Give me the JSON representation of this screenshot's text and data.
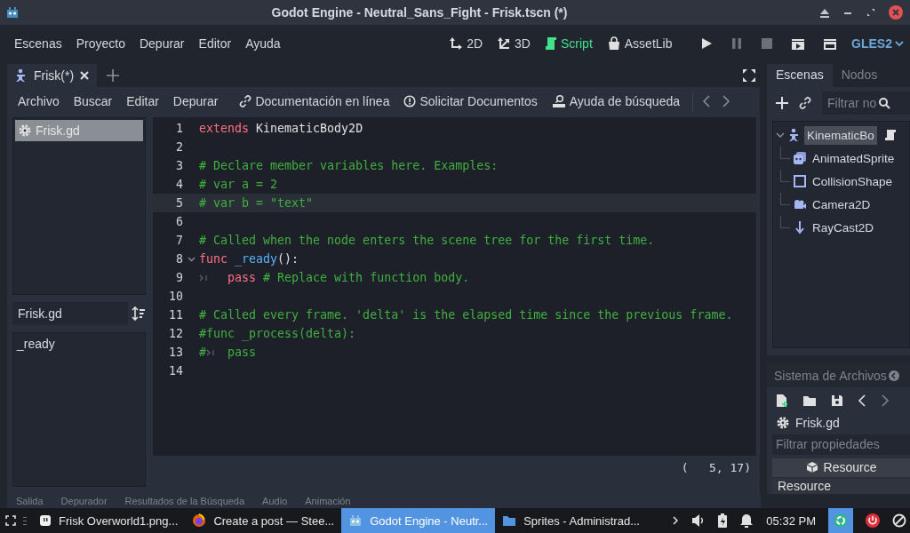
{
  "window": {
    "title": "Godot Engine - Neutral_Sans_Fight - Frisk.tscn (*)"
  },
  "menu": [
    "Escenas",
    "Proyecto",
    "Depurar",
    "Editor",
    "Ayuda"
  ],
  "workspaces": [
    {
      "kind": "plane",
      "label": "2D",
      "selected": false
    },
    {
      "kind": "space",
      "label": "3D",
      "selected": false
    },
    {
      "kind": "script",
      "label": "Script",
      "selected": true
    },
    {
      "kind": "assetlib",
      "label": "AssetLib",
      "selected": false
    }
  ],
  "renderer": "GLES2",
  "script_tabs": [
    {
      "label": "Frisk(*)",
      "selected": true
    }
  ],
  "script_menu": [
    "Archivo",
    "Buscar",
    "Editar",
    "Depurar"
  ],
  "help_buttons": [
    {
      "kind": "link",
      "label": "Documentación en línea"
    },
    {
      "kind": "info",
      "label": "Solicitar Documentos"
    },
    {
      "kind": "search",
      "label": "Ayuda de búsqueda"
    }
  ],
  "script_list": [
    {
      "name": "Frisk.gd",
      "selected": true
    }
  ],
  "method_filter": {
    "value": "Frisk.gd"
  },
  "methods": [
    "_ready"
  ],
  "code": [
    {
      "number": "1",
      "current": false,
      "foldable": false,
      "tokens": [
        {
          "kind": "keyword",
          "text": "extends"
        },
        {
          "kind": "plain",
          "text": " KinematicBody2D"
        }
      ]
    },
    {
      "number": "2",
      "current": false,
      "foldable": false
    },
    {
      "number": "3",
      "current": false,
      "foldable": false,
      "tokens": [
        {
          "kind": "comment",
          "text": "# Declare member variables here. Examples:"
        }
      ]
    },
    {
      "number": "4",
      "current": false,
      "foldable": false,
      "tokens": [
        {
          "kind": "comment",
          "text": "# var a = 2"
        }
      ]
    },
    {
      "number": "5",
      "current": true,
      "foldable": false,
      "tokens": [
        {
          "kind": "comment",
          "text": "# var b = \"text\""
        }
      ]
    },
    {
      "number": "6",
      "current": false,
      "foldable": false
    },
    {
      "number": "7",
      "current": false,
      "foldable": false,
      "tokens": [
        {
          "kind": "comment",
          "text": "# Called when the node enters the scene tree for the first time."
        }
      ]
    },
    {
      "number": "8",
      "current": false,
      "foldable": true,
      "tokens": [
        {
          "kind": "keyword",
          "text": "func"
        },
        {
          "kind": "function",
          "text": " _ready"
        },
        {
          "kind": "plain",
          "text": "():"
        }
      ]
    },
    {
      "number": "9",
      "current": false,
      "foldable": false,
      "tokens": [
        {
          "kind": "tab"
        },
        {
          "kind": "keyword",
          "text": "pass"
        },
        {
          "kind": "comment",
          "text": " # Replace with function body."
        }
      ]
    },
    {
      "number": "10",
      "current": false,
      "foldable": false
    },
    {
      "number": "11",
      "current": false,
      "foldable": false,
      "tokens": [
        {
          "kind": "comment",
          "text": "# Called every frame. 'delta' is the elapsed time since the previous frame."
        }
      ]
    },
    {
      "number": "12",
      "current": false,
      "foldable": false,
      "tokens": [
        {
          "kind": "comment",
          "text": "#func _process(delta):"
        }
      ]
    },
    {
      "number": "13",
      "current": false,
      "foldable": false,
      "tokens": [
        {
          "kind": "comment",
          "text": "#"
        },
        {
          "kind": "tab"
        },
        {
          "kind": "comment",
          "text": "pass"
        }
      ]
    },
    {
      "number": "14",
      "current": false,
      "foldable": false
    }
  ],
  "cursor": "(   5, 17)",
  "bottom_tabs": [
    "Salida",
    "Depurador",
    "Resultados de la Búsqueda",
    "Audio",
    "Animación"
  ],
  "dock_tabs": [
    {
      "label": "Escenas",
      "selected": true
    },
    {
      "label": "Nodos",
      "selected": false
    }
  ],
  "scene_filter": {
    "placeholder": "Filtrar no"
  },
  "scene_tree": {
    "kind": "kinematic",
    "name": "KinematicBo",
    "selected": true,
    "expanded": true,
    "children": [
      {
        "kind": "sprite",
        "name": "AnimatedSprite",
        "selected": false
      },
      {
        "kind": "shape",
        "name": "CollisionShape",
        "selected": false
      },
      {
        "kind": "camera",
        "name": "Camera2D",
        "selected": false
      },
      {
        "kind": "ray",
        "name": "RayCast2D",
        "selected": false
      }
    ]
  },
  "filesystem": {
    "title": "Sistema de Archivos"
  },
  "inspector": {
    "file": "Frisk.gd",
    "filter_placeholder": "Filtrar propiedades",
    "section": "Resource",
    "field": "Resource"
  },
  "taskbar": {
    "windows": [
      {
        "kind": "image",
        "label": "Frisk Overworld1.png...",
        "selected": false
      },
      {
        "kind": "browser",
        "label": "Create a post — Stee...",
        "selected": false
      },
      {
        "kind": "godot",
        "label": "Godot Engine - Neutr...",
        "selected": true
      },
      {
        "kind": "folder",
        "label": "Sprites - Administrad...",
        "selected": false
      }
    ],
    "clock": "05:32 PM"
  }
}
